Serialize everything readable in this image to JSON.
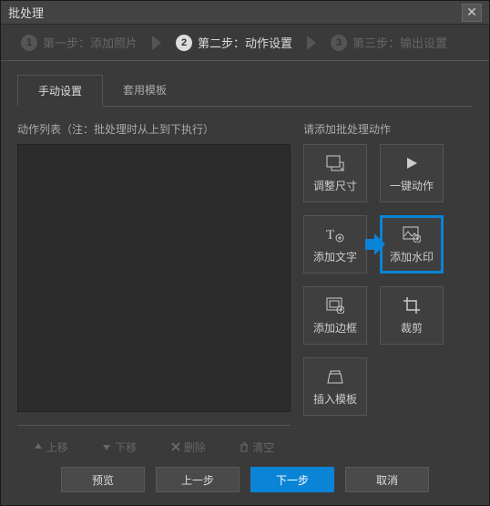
{
  "window": {
    "title": "批处理"
  },
  "steps": {
    "s1": {
      "num": "1",
      "label": "第一步：添加照片"
    },
    "s2": {
      "num": "2",
      "label": "第二步：动作设置"
    },
    "s3": {
      "num": "3",
      "label": "第三步：输出设置"
    }
  },
  "tabs": {
    "manual": "手动设置",
    "template": "套用模板"
  },
  "left": {
    "title": "动作列表（注：批处理时从上到下执行）",
    "moveup": "上移",
    "movedown": "下移",
    "delete": "删除",
    "clear": "清空"
  },
  "right": {
    "title": "请添加批处理动作",
    "resize": "调整尺寸",
    "oneclick": "一键动作",
    "addtext": "添加文字",
    "watermark": "添加水印",
    "border": "添加边框",
    "crop": "裁剪",
    "inserttpl": "插入模板"
  },
  "footer": {
    "preview": "预览",
    "prev": "上一步",
    "next": "下一步",
    "cancel": "取消"
  }
}
